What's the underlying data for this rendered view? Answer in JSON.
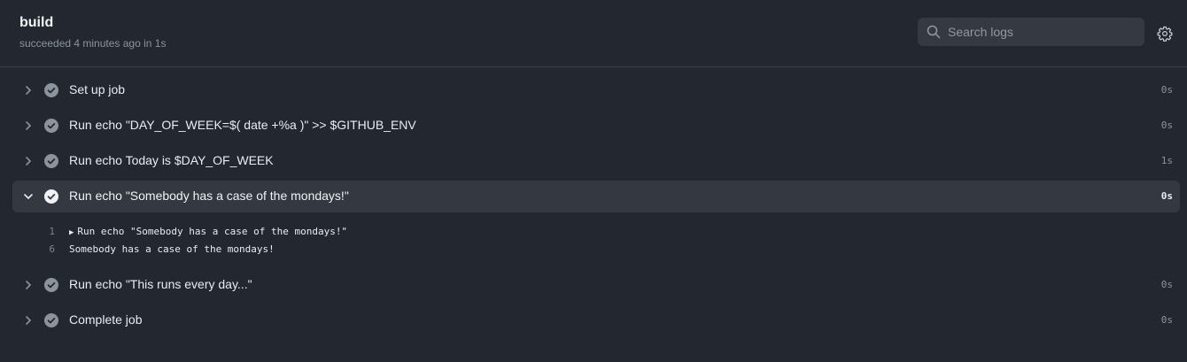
{
  "header": {
    "title": "build",
    "subtitle": "succeeded 4 minutes ago in 1s",
    "search_placeholder": "Search logs"
  },
  "colors": {
    "background": "#23272f",
    "expanded_row": "#333841",
    "check_muted": "#8b949e",
    "check_active": "#f0f3f6"
  },
  "icons": [
    "search-icon",
    "gear-icon",
    "chevron-right-icon",
    "chevron-down-icon",
    "check-circle-icon",
    "triangle-right-icon"
  ],
  "steps": [
    {
      "label": "Set up job",
      "duration": "0s"
    },
    {
      "label": "Run echo \"DAY_OF_WEEK=$( date +%a )\" >> $GITHUB_ENV",
      "duration": "0s"
    },
    {
      "label": "Run echo Today is $DAY_OF_WEEK",
      "duration": "1s"
    },
    {
      "label": "Run echo \"Somebody has a case of the mondays!\"",
      "duration": "0s",
      "expanded": true
    },
    {
      "label": "Run echo \"This runs every day...\"",
      "duration": "0s"
    },
    {
      "label": "Complete job",
      "duration": "0s"
    }
  ],
  "log_lines": [
    {
      "number": "1",
      "text": "Run echo \"Somebody has a case of the mondays!\"",
      "collapsible": true
    },
    {
      "number": "6",
      "text": "Somebody has a case of the mondays!"
    }
  ]
}
